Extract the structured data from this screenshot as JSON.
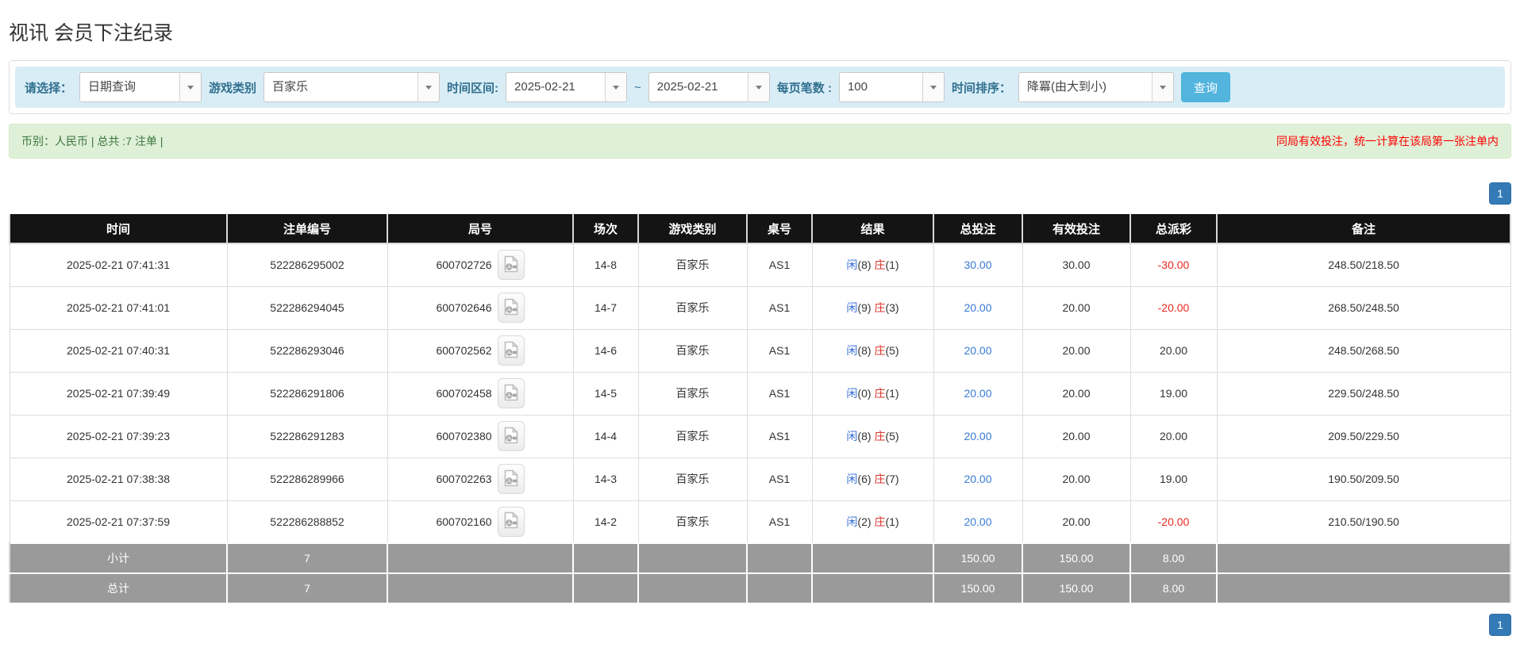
{
  "page": {
    "title": "视讯 会员下注纪录"
  },
  "filter": {
    "select_label": "请选择：",
    "select_value": "日期查询",
    "game_label": "游戏类别",
    "game_value": "百家乐",
    "range_label": "时间区间:",
    "date_from": "2025-02-21",
    "range_separator": "~",
    "date_to": "2025-02-21",
    "page_size_label": "每页笔数 :",
    "page_size": "100",
    "sort_label": "时间排序：",
    "sort_value": "降冪(由大到小)",
    "query_button": "查询"
  },
  "summary": {
    "currency_info": "币别：人民币 | 总共 :7 注单 |",
    "notice": "同局有效投注，统一计算在该局第一张注单内"
  },
  "pagination": {
    "current_page": "1"
  },
  "colors": {
    "accent_blue": "#337ab7",
    "link_blue": "#3a7bd5",
    "negative_red": "#ea2a21",
    "player_blue": "#3a6fd8",
    "banker_red": "#d9342b",
    "success_green": "#3c763d",
    "notice_red": "#ff0000",
    "header_black": "#141414",
    "footer_gray": "#9a9a9a",
    "filter_bg": "#d9edf7"
  },
  "icons": {
    "combo_arrow": "chevron-down-icon",
    "round_video": "video-file-icon"
  },
  "table": {
    "headers": [
      "时间",
      "注单编号",
      "局号",
      "场次",
      "游戏类别",
      "桌号",
      "结果",
      "总投注",
      "有效投注",
      "总派彩",
      "备注"
    ],
    "rows": [
      {
        "time": "2025-02-21 07:41:31",
        "bet_id": "522286295002",
        "round_id": "600702726",
        "session": "14-8",
        "game": "百家乐",
        "table_id": "AS1",
        "result": {
          "player": "闲",
          "player_score": "(8)",
          "banker": "庄",
          "banker_score": "(1)"
        },
        "total_bet": "30.00",
        "valid_bet": "30.00",
        "payout": "-30.00",
        "note": "248.50/218.50"
      },
      {
        "time": "2025-02-21 07:41:01",
        "bet_id": "522286294045",
        "round_id": "600702646",
        "session": "14-7",
        "game": "百家乐",
        "table_id": "AS1",
        "result": {
          "player": "闲",
          "player_score": "(9)",
          "banker": "庄",
          "banker_score": "(3)"
        },
        "total_bet": "20.00",
        "valid_bet": "20.00",
        "payout": "-20.00",
        "note": "268.50/248.50"
      },
      {
        "time": "2025-02-21 07:40:31",
        "bet_id": "522286293046",
        "round_id": "600702562",
        "session": "14-6",
        "game": "百家乐",
        "table_id": "AS1",
        "result": {
          "player": "闲",
          "player_score": "(8)",
          "banker": "庄",
          "banker_score": "(5)"
        },
        "total_bet": "20.00",
        "valid_bet": "20.00",
        "payout": "20.00",
        "note": "248.50/268.50"
      },
      {
        "time": "2025-02-21 07:39:49",
        "bet_id": "522286291806",
        "round_id": "600702458",
        "session": "14-5",
        "game": "百家乐",
        "table_id": "AS1",
        "result": {
          "player": "闲",
          "player_score": "(0)",
          "banker": "庄",
          "banker_score": "(1)"
        },
        "total_bet": "20.00",
        "valid_bet": "20.00",
        "payout": "19.00",
        "note": "229.50/248.50"
      },
      {
        "time": "2025-02-21 07:39:23",
        "bet_id": "522286291283",
        "round_id": "600702380",
        "session": "14-4",
        "game": "百家乐",
        "table_id": "AS1",
        "result": {
          "player": "闲",
          "player_score": "(8)",
          "banker": "庄",
          "banker_score": "(5)"
        },
        "total_bet": "20.00",
        "valid_bet": "20.00",
        "payout": "20.00",
        "note": "209.50/229.50"
      },
      {
        "time": "2025-02-21 07:38:38",
        "bet_id": "522286289966",
        "round_id": "600702263",
        "session": "14-3",
        "game": "百家乐",
        "table_id": "AS1",
        "result": {
          "player": "闲",
          "player_score": "(6)",
          "banker": "庄",
          "banker_score": "(7)"
        },
        "total_bet": "20.00",
        "valid_bet": "20.00",
        "payout": "19.00",
        "note": "190.50/209.50"
      },
      {
        "time": "2025-02-21 07:37:59",
        "bet_id": "522286288852",
        "round_id": "600702160",
        "session": "14-2",
        "game": "百家乐",
        "table_id": "AS1",
        "result": {
          "player": "闲",
          "player_score": "(2)",
          "banker": "庄",
          "banker_score": "(1)"
        },
        "total_bet": "20.00",
        "valid_bet": "20.00",
        "payout": "-20.00",
        "note": "210.50/190.50"
      }
    ],
    "subtotal": {
      "label": "小计",
      "count": "7",
      "total_bet": "150.00",
      "valid_bet": "150.00",
      "payout": "8.00"
    },
    "total": {
      "label": "总计",
      "count": "7",
      "total_bet": "150.00",
      "valid_bet": "150.00",
      "payout": "8.00"
    }
  }
}
